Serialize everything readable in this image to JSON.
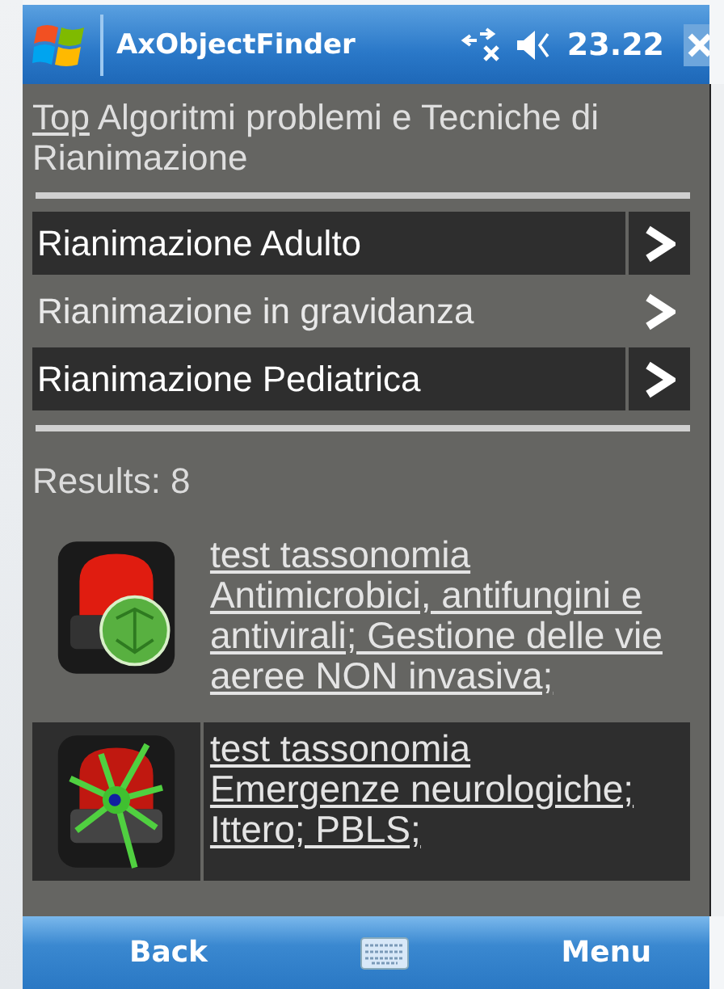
{
  "title_bar": {
    "title": "AxObjectFinder",
    "time": "23.22"
  },
  "breadcrumb": {
    "link": "Top",
    "text": "Algoritmi problemi e Tecniche di Rianimazione"
  },
  "categories": [
    {
      "label": "Rianimazione Adulto"
    },
    {
      "label": "Rianimazione in gravidanza"
    },
    {
      "label": "Rianimazione Pediatrica"
    }
  ],
  "results": {
    "label": "Results: 8",
    "items": [
      {
        "kind": "germ",
        "title": "test tassonomia",
        "description": "Antimicrobici, antifungini e antivirali; Gestione delle vie aeree NON invasiva;"
      },
      {
        "kind": "neuron",
        "title": "test tassonomia",
        "description": "Emergenze neurologiche; Ittero; PBLS;"
      }
    ]
  },
  "soft_keys": {
    "left": "Back",
    "right": "Menu"
  }
}
